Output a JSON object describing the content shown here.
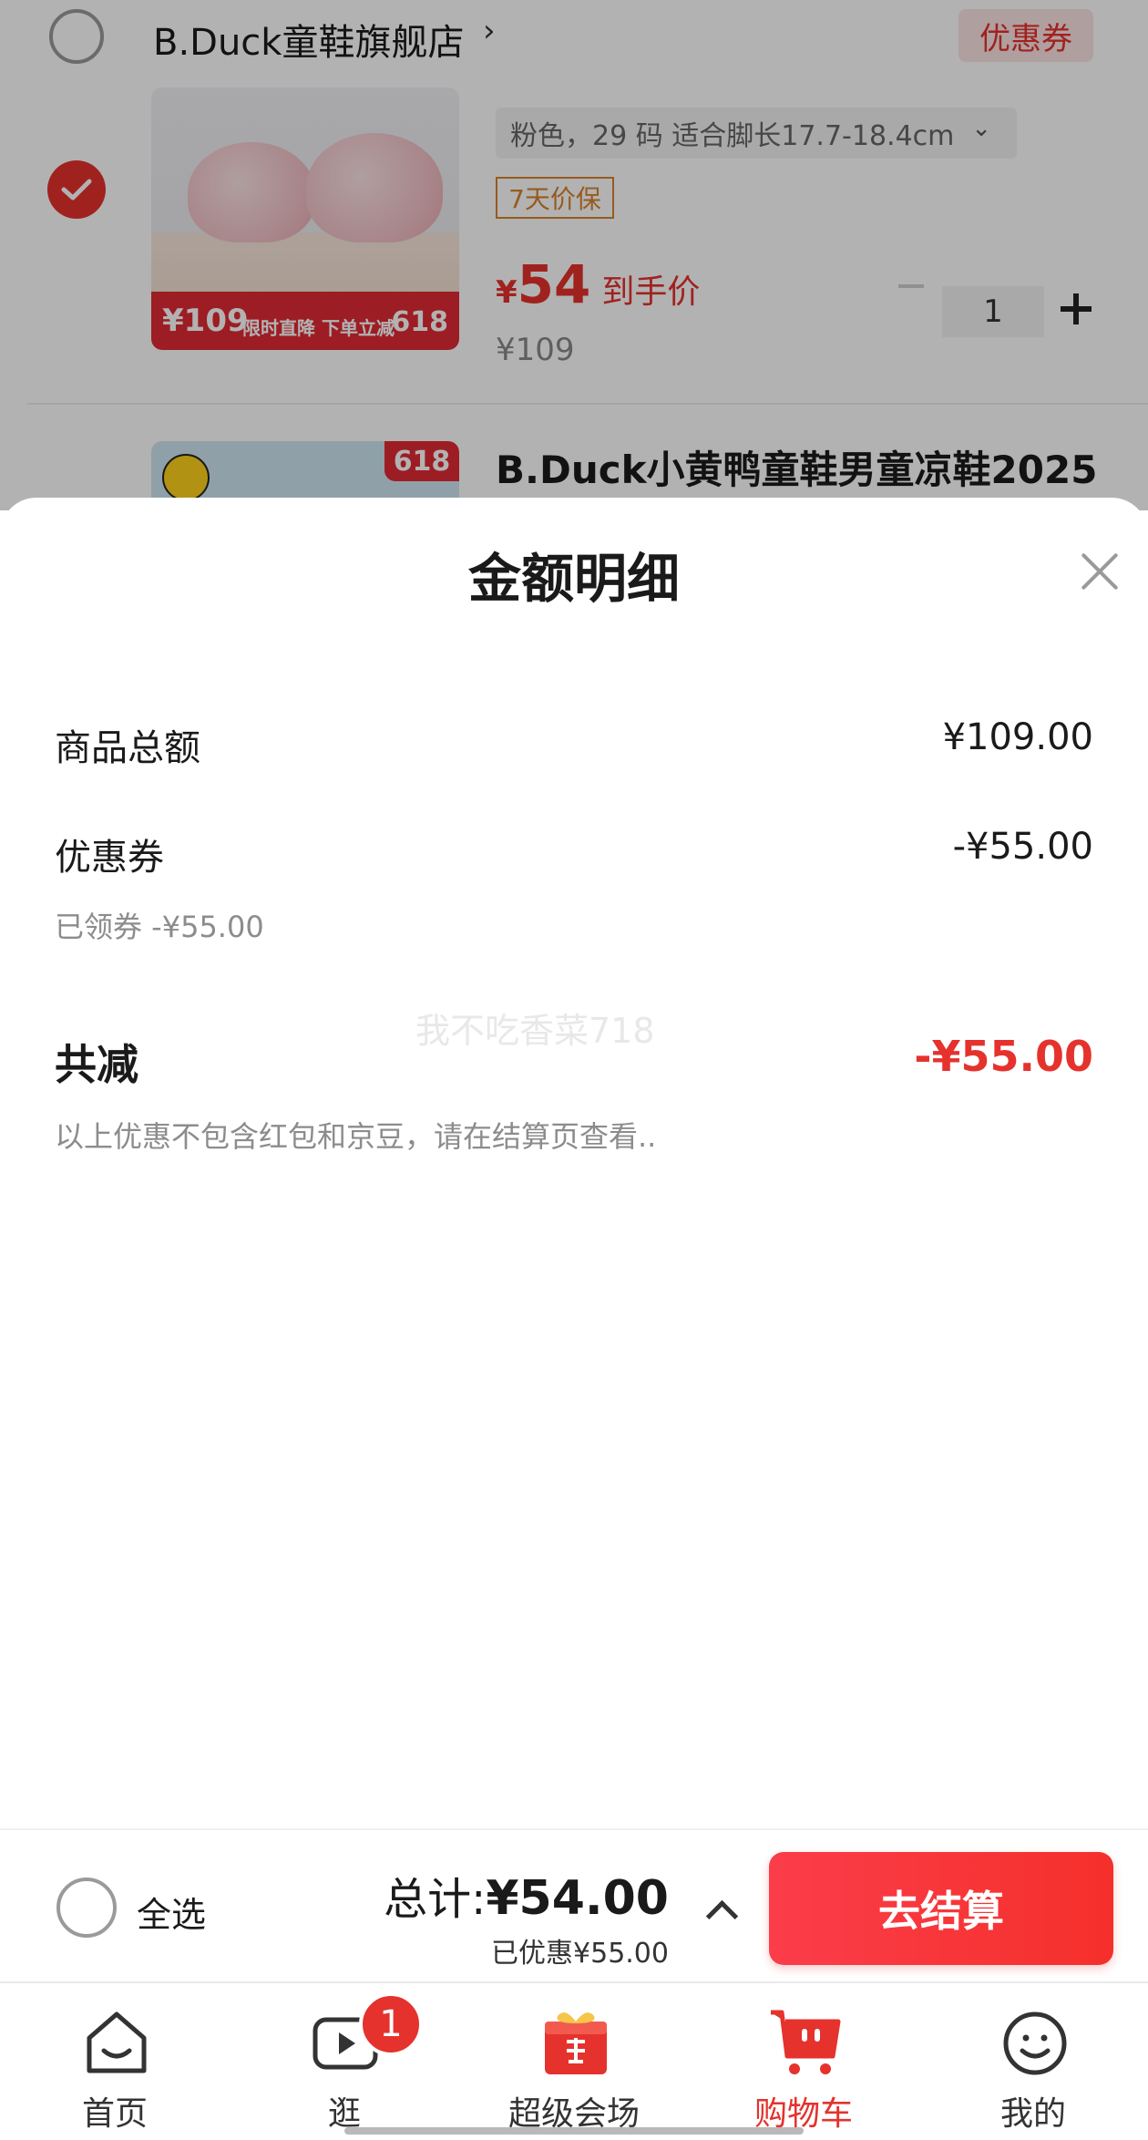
{
  "store": {
    "name": "B.Duck童鞋旗舰店",
    "arrow": "›",
    "coupon_tag": "优惠券"
  },
  "product1": {
    "spec": "粉色，29 码 适合脚长17.7-18.4cm",
    "spec_chevron": "⌄",
    "price_protect_tag": "7天价保",
    "price_currency": "¥",
    "price_value": "54",
    "price_label": "到手价",
    "old_price": "¥109",
    "quantity": "1",
    "promo_price": "¥109",
    "promo_text": "限时直降 下单立减",
    "promo_badge": "618"
  },
  "product2": {
    "title": "B.Duck小黄鸭童鞋男童凉鞋2025",
    "badge": "618"
  },
  "sheet": {
    "title": "金额明细",
    "rows": [
      {
        "label": "商品总额",
        "value": "¥109.00"
      },
      {
        "label": "优惠券",
        "value": "-¥55.00",
        "sub": "已领券 -¥55.00"
      }
    ],
    "total": {
      "label": "共减",
      "value": "-¥55.00",
      "note": "以上优惠不包含红包和京豆，请在结算页查看.."
    },
    "watermark": "我不吃香菜718"
  },
  "checkout": {
    "select_all": "全选",
    "total_label": "总计:",
    "total_value": "¥54.00",
    "discount_note": "已优惠¥55.00",
    "button": "去结算"
  },
  "tabbar": {
    "items": [
      {
        "label": "首页",
        "icon": "home-icon",
        "active": false
      },
      {
        "label": "逛",
        "icon": "video-icon",
        "active": false,
        "badge": "1"
      },
      {
        "label": "超级会场",
        "icon": "gift-icon",
        "active": false
      },
      {
        "label": "购物车",
        "icon": "cart-icon",
        "active": true
      },
      {
        "label": "我的",
        "icon": "profile-icon",
        "active": false
      }
    ]
  },
  "colors": {
    "accent": "#e5322d",
    "price_protect": "#d9822b"
  }
}
